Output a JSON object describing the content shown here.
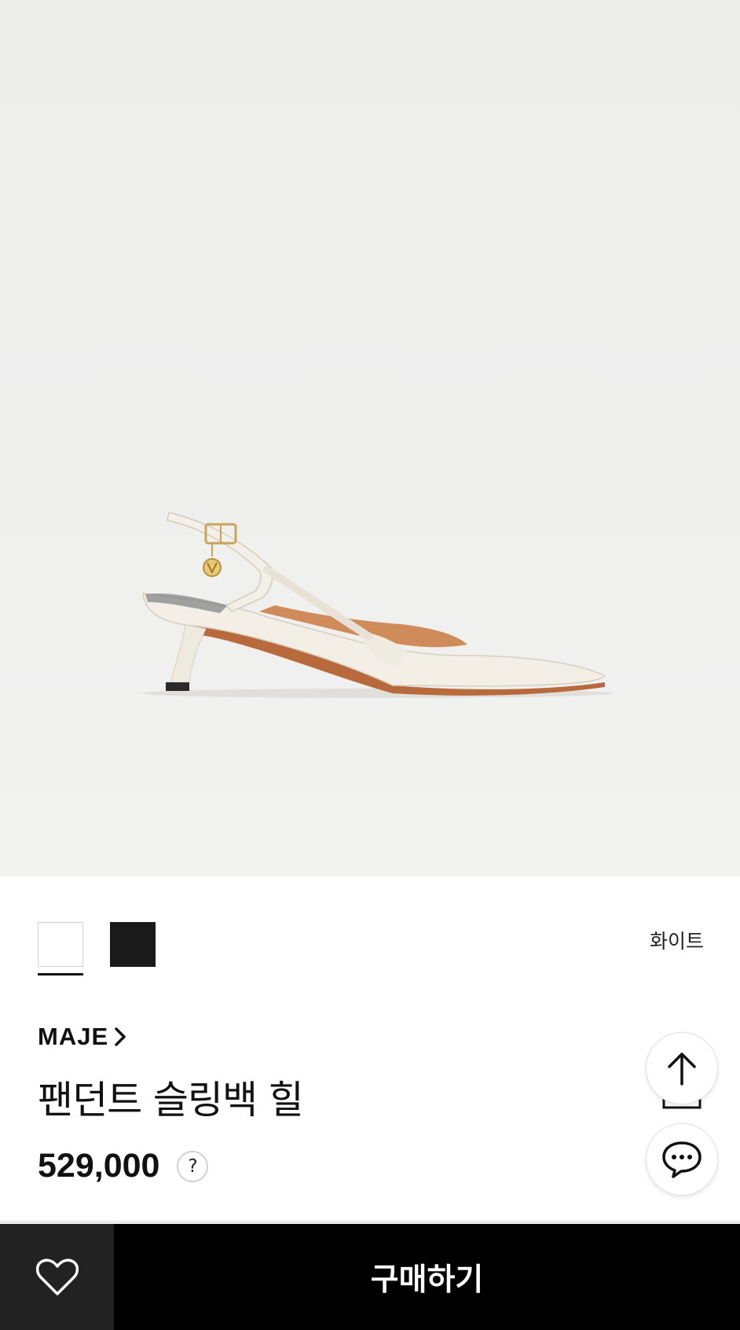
{
  "product_image": {
    "icon": "slingback-heel-photo"
  },
  "color_options": {
    "swatches": [
      {
        "name": "white-swatch",
        "color": "#ffffff",
        "selected": true
      },
      {
        "name": "black-swatch",
        "color": "#1a1a1a",
        "selected": false
      }
    ],
    "selected_label": "화이트"
  },
  "product": {
    "brand": "MAJE",
    "name": "팬던트 슬링백 힐",
    "price": "529,000",
    "price_help": "?"
  },
  "floating_actions": {
    "scroll_top_icon": "arrow-up-icon",
    "share_icon": "share-icon",
    "chat_icon": "chat-bubble-icon"
  },
  "bottom_bar": {
    "wishlist_icon": "heart-icon",
    "buy_label": "구매하기"
  }
}
